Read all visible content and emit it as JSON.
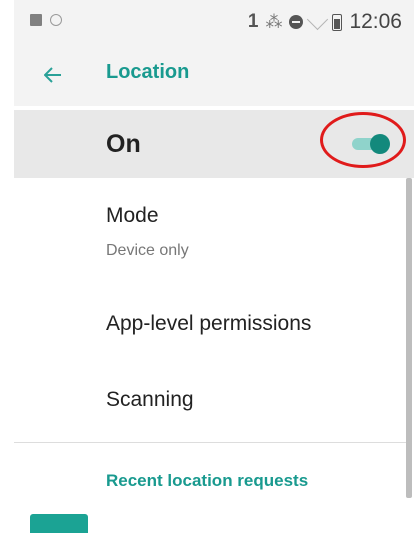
{
  "status_bar": {
    "left_icons": [
      "image-icon",
      "circle-icon"
    ],
    "sim_indicator": "1",
    "bluetooth_icon": "bluetooth-icon",
    "dnd_icon": "do-not-disturb-icon",
    "wifi_icon": "wifi-icon",
    "battery_icon": "battery-icon",
    "time": "12:06"
  },
  "app_bar": {
    "back_icon": "arrow-left-icon",
    "title": "Location"
  },
  "master_switch": {
    "label": "On",
    "checked": true
  },
  "settings": {
    "mode": {
      "title": "Mode",
      "summary": "Device only"
    },
    "permissions": {
      "title": "App-level permissions"
    },
    "scanning": {
      "title": "Scanning"
    }
  },
  "recent_requests": {
    "header": "Recent location requests"
  },
  "colors": {
    "accent": "#199a8f",
    "toggle_thumb": "#13897c",
    "toggle_track": "#8fd3cb",
    "annotation": "#e01b1b"
  }
}
